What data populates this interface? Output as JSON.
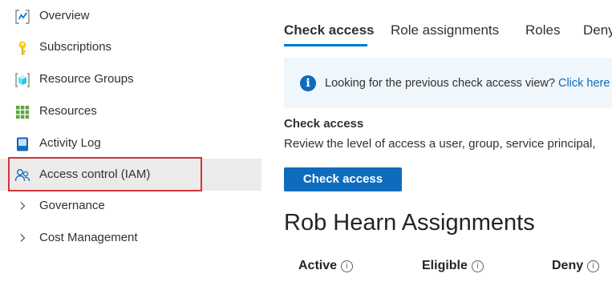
{
  "sidebar": {
    "items": [
      {
        "label": "Overview",
        "icon": "overview-icon"
      },
      {
        "label": "Subscriptions",
        "icon": "key-icon"
      },
      {
        "label": "Resource Groups",
        "icon": "resource-group-icon"
      },
      {
        "label": "Resources",
        "icon": "grid-icon"
      },
      {
        "label": "Activity Log",
        "icon": "activity-log-icon"
      },
      {
        "label": "Access control (IAM)",
        "icon": "people-icon",
        "selected": true
      },
      {
        "label": "Governance",
        "icon": "chevron-right-icon"
      },
      {
        "label": "Cost Management",
        "icon": "chevron-right-icon"
      }
    ]
  },
  "tabs": [
    {
      "label": "Check access",
      "active": true
    },
    {
      "label": "Role assignments"
    },
    {
      "label": "Roles"
    },
    {
      "label": "Deny"
    }
  ],
  "info_bar": {
    "text": "Looking for the previous check access view?",
    "link": "Click here"
  },
  "check_access": {
    "title": "Check access",
    "description": "Review the level of access a user, group, service principal,",
    "button_label": "Check access"
  },
  "assignments": {
    "title": "Rob Hearn Assignments",
    "columns": [
      "Active",
      "Eligible",
      "Deny"
    ]
  },
  "colors": {
    "accent": "#0f6cbd",
    "selection_outline": "#d13438",
    "info_background": "#eff6fc"
  }
}
